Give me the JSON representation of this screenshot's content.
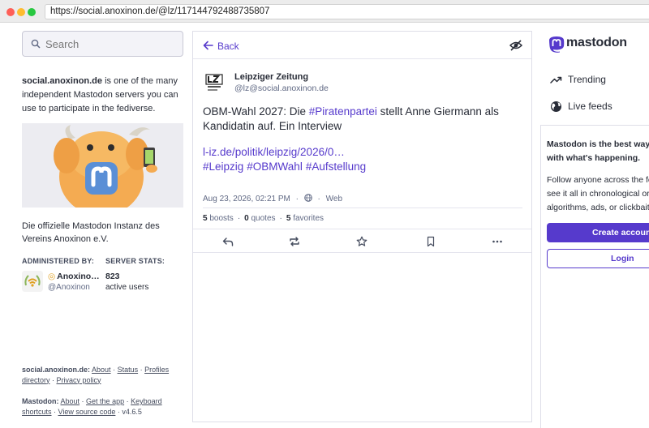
{
  "browser": {
    "url": "https://social.anoxinon.de/@lz/117144792488735807"
  },
  "sidebar": {
    "search_placeholder": "Search",
    "about_domain": "social.anoxinon.de",
    "about_rest": " is one of the many independent Mastodon servers you can use to participate in the fediverse.",
    "description": "Die offizielle Mastodon Instanz des Vereins Anoxinon e.V.",
    "administered_by_label": "ADMINISTERED BY:",
    "server_stats_label": "SERVER STATS:",
    "admin_name": "Anoxino…",
    "admin_handle": "@Anoxinon",
    "active_users_count": "823",
    "active_users_label": "active users",
    "footer_server": {
      "label": "social.anoxinon.de:",
      "links": [
        "About",
        "Status",
        "Profiles directory",
        "Privacy policy"
      ]
    },
    "footer_mastodon": {
      "label": "Mastodon:",
      "links": [
        "About",
        "Get the app",
        "Keyboard shortcuts",
        "View source code"
      ],
      "version": "v4.6.5"
    }
  },
  "post": {
    "back_label": "Back",
    "author_name": "Leipziger Zeitung",
    "author_handle": "@lz@social.anoxinon.de",
    "text_before": "OBM-Wahl 2027: Die ",
    "text_tag": "#Piratenpartei",
    "text_after": " stellt Anne Giermann als Kandidatin auf. Ein Interview",
    "link": "l-iz.de/politik/leipzig/2026/0…",
    "hashtags": [
      "#Leipzig",
      "#OBMWahl",
      "#Aufstellung"
    ],
    "timestamp": "Aug 23, 2026, 02:21 PM",
    "source": "Web",
    "boosts_count": "5",
    "boosts_label": "boosts",
    "quotes_count": "0",
    "quotes_label": "quotes",
    "favorites_count": "5",
    "favorites_label": "favorites"
  },
  "right": {
    "logo_text": "mastodon",
    "nav": [
      "Trending",
      "Live feeds"
    ],
    "cta_bold_line1": "Mastodon is the best way t",
    "cta_bold_line2": "with what's happening.",
    "cta_line1": "Follow anyone across the fe",
    "cta_line2": "see it all in chronological or",
    "cta_line3": "algorithms, ads, or clickbait",
    "create_account": "Create account",
    "login": "Login"
  },
  "colors": {
    "accent": "#563acc",
    "text": "#282c37",
    "muted": "#606984"
  },
  "icons": [
    "search-icon",
    "back-arrow-icon",
    "eye-off-icon",
    "globe-icon",
    "reply-icon",
    "boost-icon",
    "star-icon",
    "bookmark-icon",
    "more-icon",
    "trending-icon"
  ]
}
